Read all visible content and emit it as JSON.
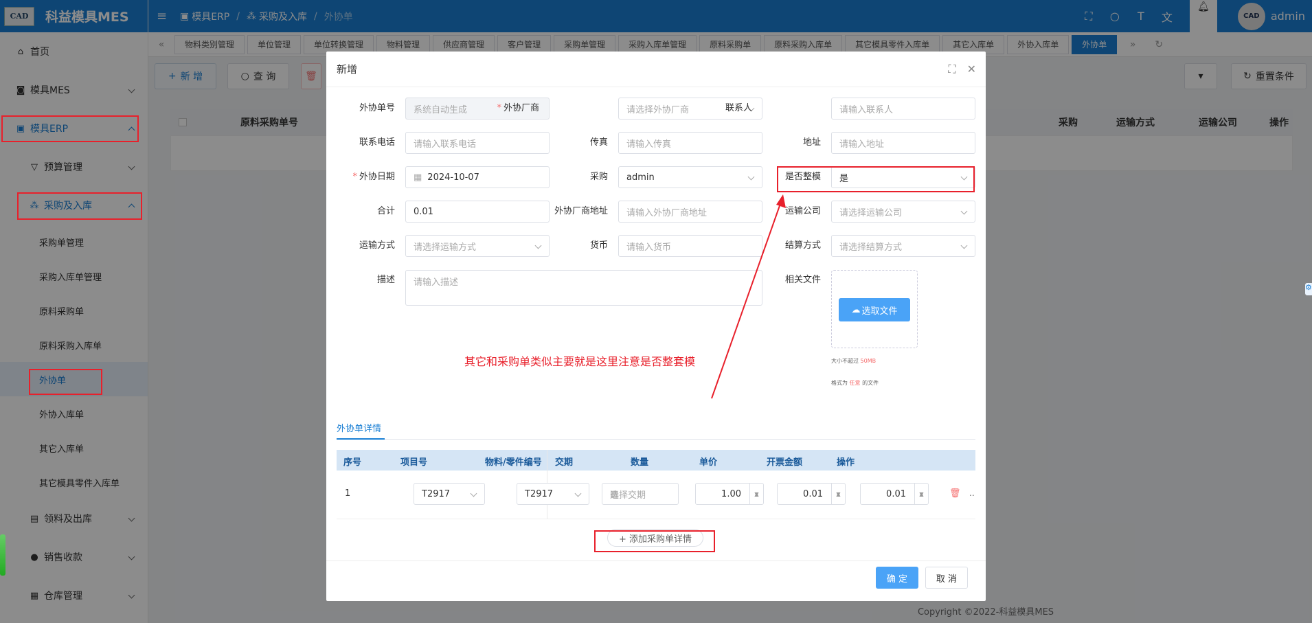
{
  "app": {
    "title": "科益模具MES",
    "logo_text": "CAD"
  },
  "sidebar": {
    "items": [
      {
        "label": "首页"
      },
      {
        "label": "模具MES"
      },
      {
        "label": "模具ERP"
      },
      {
        "label": "预算管理"
      },
      {
        "label": "采购及入库"
      },
      {
        "label": "采购单管理"
      },
      {
        "label": "采购入库单管理"
      },
      {
        "label": "原料采购单"
      },
      {
        "label": "原料采购入库单"
      },
      {
        "label": "外协单"
      },
      {
        "label": "外协入库单"
      },
      {
        "label": "其它入库单"
      },
      {
        "label": "其它模具零件入库单"
      },
      {
        "label": "领料及出库"
      },
      {
        "label": "销售收款"
      },
      {
        "label": "仓库管理"
      }
    ]
  },
  "header": {
    "breadcrumb": [
      "模具ERP",
      "采购及入库",
      "外协单"
    ],
    "user": "admin"
  },
  "tabs": [
    "物料类别管理",
    "单位管理",
    "单位转换管理",
    "物料管理",
    "供应商管理",
    "客户管理",
    "采购单管理",
    "采购入库单管理",
    "原料采购单",
    "原料采购入库单",
    "其它模具零件入库单",
    "其它入库单",
    "外协入库单",
    "外协单"
  ],
  "toolbar": {
    "add": "新 增",
    "query": "查 询",
    "reset": "重置条件"
  },
  "grid": {
    "columns": [
      "原料采购单号",
      "采购",
      "运输方式",
      "运输公司",
      "操作"
    ]
  },
  "footer": {
    "copyright": "Copyright ©2022-科益模具MES"
  },
  "dialog": {
    "title": "新增",
    "fields": {
      "order_no": {
        "label": "外协单号",
        "placeholder": "系统自动生成"
      },
      "vendor": {
        "label": "外协厂商",
        "placeholder": "请选择外协厂商"
      },
      "contact": {
        "label": "联系人",
        "placeholder": "请输入联系人"
      },
      "phone": {
        "label": "联系电话",
        "placeholder": "请输入联系电话"
      },
      "fax": {
        "label": "传真",
        "placeholder": "请输入传真"
      },
      "address": {
        "label": "地址",
        "placeholder": "请输入地址"
      },
      "date": {
        "label": "外协日期",
        "value": "2024-10-07"
      },
      "purchaser": {
        "label": "采购",
        "value": "admin"
      },
      "whole_mold": {
        "label": "是否整模",
        "value": "是"
      },
      "total": {
        "label": "合计",
        "value": "0.01"
      },
      "vendor_addr": {
        "label": "外协厂商地址",
        "placeholder": "请输入外协厂商地址"
      },
      "carrier": {
        "label": "运输公司",
        "placeholder": "请选择运输公司"
      },
      "ship_method": {
        "label": "运输方式",
        "placeholder": "请选择运输方式"
      },
      "currency": {
        "label": "货币",
        "placeholder": "请输入货币"
      },
      "settle": {
        "label": "结算方式",
        "placeholder": "请选择结算方式"
      },
      "desc": {
        "label": "描述",
        "placeholder": "请输入描述"
      },
      "files": {
        "label": "相关文件",
        "button": "选取文件"
      }
    },
    "upload_hint": {
      "size_pre": "大小不超过 ",
      "size": "50MB",
      "fmt_pre": "格式为 ",
      "fmt": "任意",
      "fmt_post": " 的文件"
    },
    "annotation": "其它和采购单类似主要就是这里注意是否整套模",
    "detail_tab": "外协单详情",
    "detail_columns": [
      "序号",
      "项目号",
      "物料/零件编号",
      "交期",
      "数量",
      "单价",
      "开票金额",
      "操作"
    ],
    "detail_rows": [
      {
        "seq": "1",
        "project": "T2917",
        "part": "T2917",
        "due_placeholder": "选择交期",
        "qty": "1.00",
        "price": "0.01",
        "amount": "0.01"
      }
    ],
    "add_detail": "+ 添加采购单详情",
    "confirm": "确 定",
    "cancel": "取 消"
  }
}
